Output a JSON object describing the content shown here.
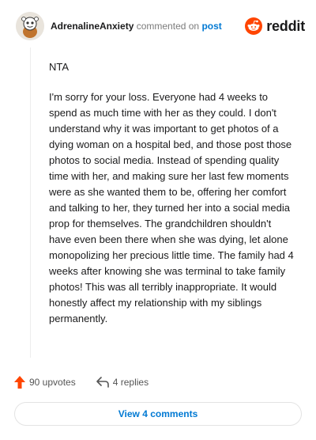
{
  "header": {
    "username": "AdrenalineAnxiety",
    "action": "commented on",
    "target": "post",
    "brand": "reddit"
  },
  "comment": {
    "paragraphs": [
      "NTA",
      "I'm sorry for your loss. Everyone had 4 weeks to spend as much time with her as they could. I don't understand why it was important to get photos of a dying woman on a hospital bed, and those post those photos to social media. Instead of spending quality time with her, and making sure her last few moments were as she wanted them to be, offering her comfort and talking to her, they turned her into a social media prop for themselves. The grandchildren shouldn't have even been there when she was dying, let alone monopolizing her precious little time. The family had 4 weeks after knowing she was terminal to take family photos! This was all terribly inappropriate. It would honestly affect my relationship with my siblings permanently."
    ]
  },
  "footer": {
    "upvotes": "90 upvotes",
    "replies": "4 replies",
    "view_comments": "View 4 comments"
  },
  "colors": {
    "upvote_arrow": "#ff4500",
    "link_blue": "#0079d3",
    "reddit_orange": "#ff4500"
  },
  "icons": {
    "avatar": "snoo-avatar-icon",
    "upvote": "upvote-arrow-icon",
    "reply": "reply-arrow-icon",
    "brand": "reddit-logo-icon"
  }
}
